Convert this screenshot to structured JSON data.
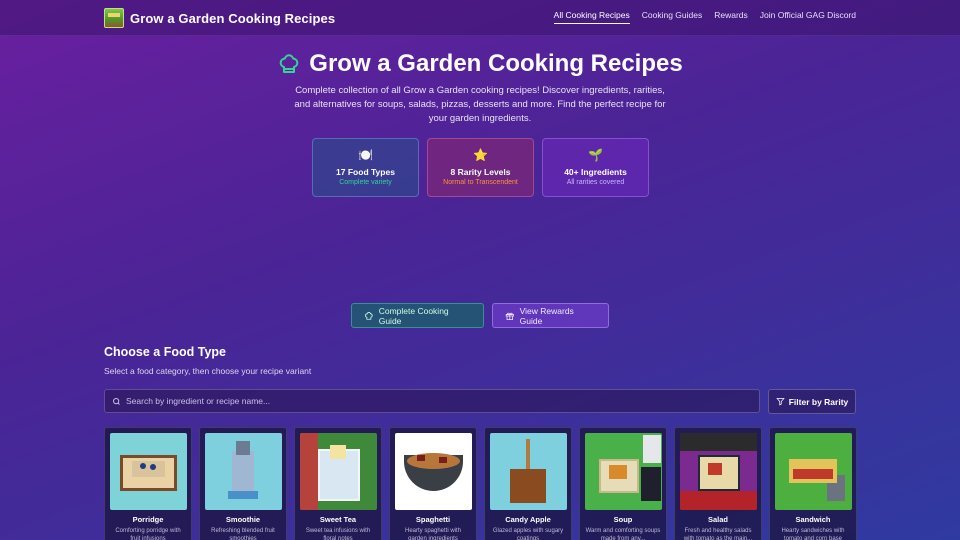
{
  "header": {
    "brand_title": "Grow a Garden Cooking Recipes",
    "nav": [
      {
        "label": "All Cooking Recipes",
        "active": true
      },
      {
        "label": "Cooking Guides"
      },
      {
        "label": "Rewards"
      },
      {
        "label": "Join Official GAG Discord"
      }
    ]
  },
  "hero": {
    "title": "Grow a Garden Cooking Recipes",
    "title_icon": "chef-hat-icon",
    "description": "Complete collection of all Grow a Garden cooking recipes! Discover ingredients, rarities, and alternatives for soups, salads, pizzas, desserts and more. Find the perfect recipe for your garden ingredients."
  },
  "stats": [
    {
      "icon": "🍽️",
      "icon_name": "plate-icon",
      "title": "17 Food Types",
      "sub": "Complete variety",
      "accent": "#34d399"
    },
    {
      "icon": "⭐",
      "icon_name": "star-icon",
      "title": "8 Rarity Levels",
      "sub": "Normal to Transcendent",
      "accent": "#fb923c"
    },
    {
      "icon": "🌱",
      "icon_name": "seedling-icon",
      "title": "40+ Ingredients",
      "sub": "All rarities covered",
      "accent": "#c4b5fd"
    }
  ],
  "guide_buttons": {
    "cooking_guide": "Complete Cooking Guide",
    "rewards_guide": "View Rewards Guide"
  },
  "food_section": {
    "title": "Choose a Food Type",
    "subtitle": "Select a food category, then choose your recipe variant",
    "search_placeholder": "Search by ingredient or recipe name...",
    "filter_label": "Filter by Rarity"
  },
  "foods": [
    {
      "name": "Porridge",
      "desc": "Comforting porridge with fruit infusions"
    },
    {
      "name": "Smoothie",
      "desc": "Refreshing blended fruit smoothies"
    },
    {
      "name": "Sweet Tea",
      "desc": "Sweet tea infusions with floral notes"
    },
    {
      "name": "Spaghetti",
      "desc": "Hearty spaghetti with garden ingredients"
    },
    {
      "name": "Candy Apple",
      "desc": "Glazed apples with sugary coatings"
    },
    {
      "name": "Soup",
      "desc": "Warm and comforting soups made from any..."
    },
    {
      "name": "Salad",
      "desc": "Fresh and healthy salads with tomato as the main..."
    },
    {
      "name": "Sandwich",
      "desc": "Hearty sandwiches with tomato and corn base"
    }
  ],
  "colors": {
    "accent_green": "#34d399",
    "accent_orange": "#fb923c",
    "accent_purple": "#c4b5fd"
  }
}
